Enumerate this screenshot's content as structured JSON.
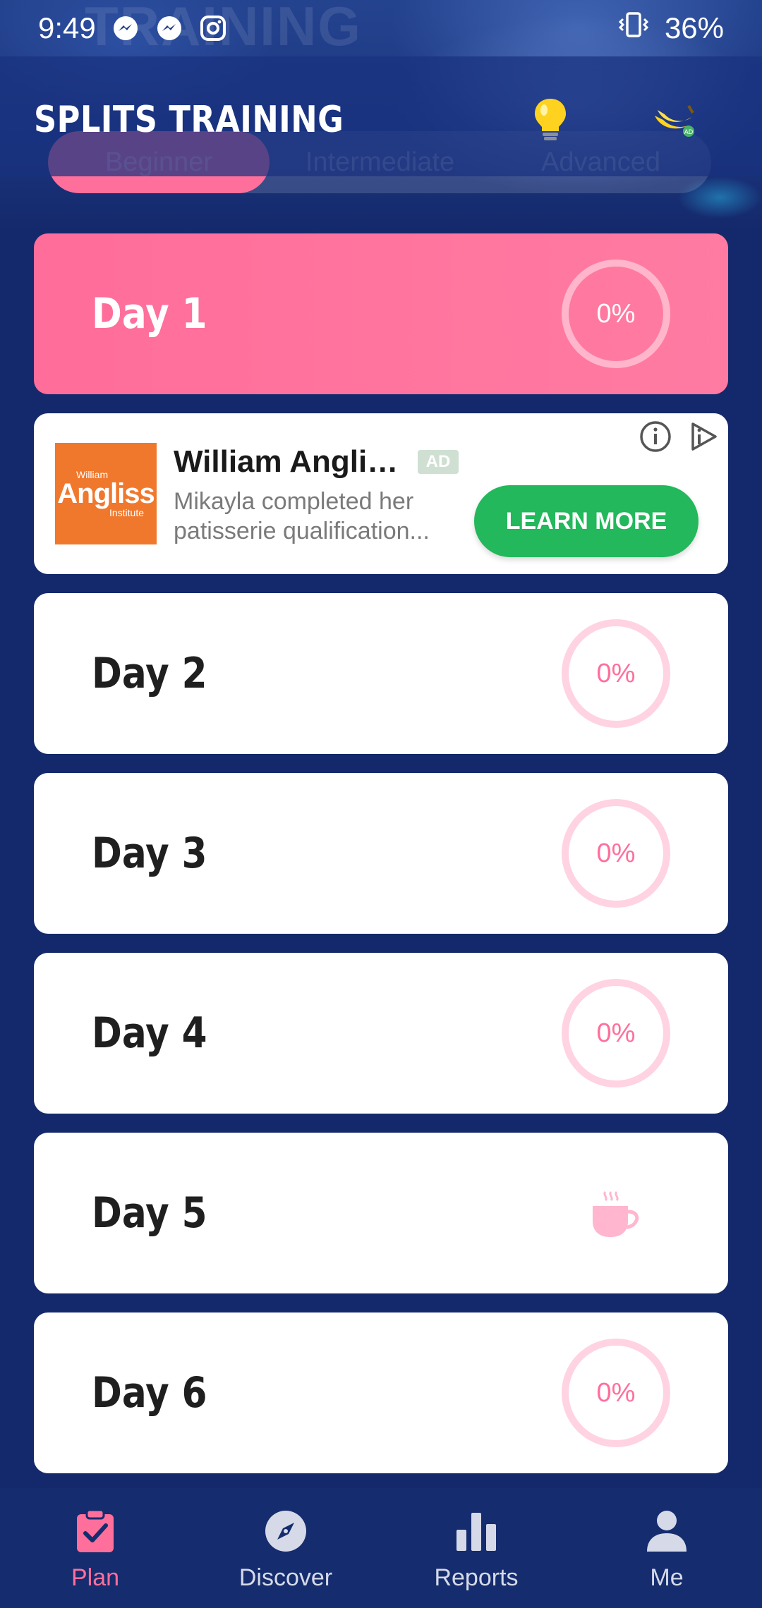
{
  "status_bar": {
    "time": "9:49",
    "app_icons": [
      "messenger-icon",
      "messenger-icon",
      "instagram-icon"
    ],
    "battery": "36%"
  },
  "header": {
    "title": "SPLITS TRAINING",
    "background_text": "TRAINING",
    "level_tabs": [
      {
        "label": "Beginner",
        "active": true
      },
      {
        "label": "Intermediate",
        "active": false
      },
      {
        "label": "Advanced",
        "active": false
      }
    ]
  },
  "days": [
    {
      "label": "Day 1",
      "progress": "0%",
      "active": true
    },
    {
      "label": "Day 2",
      "progress": "0%"
    },
    {
      "label": "Day 3",
      "progress": "0%"
    },
    {
      "label": "Day 4",
      "progress": "0%"
    },
    {
      "label": "Day 5",
      "rest_day": true,
      "icon": "coffee-cup-icon"
    },
    {
      "label": "Day 6",
      "progress": "0%"
    }
  ],
  "ad": {
    "logo_small": "William",
    "logo_main": "Angliss",
    "logo_sub": "Institute",
    "title": "William Anglis...",
    "badge": "AD",
    "body_line1": "Mikayla completed her",
    "body_line2": "patisserie qualification...",
    "cta": "LEARN MORE"
  },
  "bottom_nav": [
    {
      "label": "Plan",
      "icon": "clipboard-check-icon",
      "active": true
    },
    {
      "label": "Discover",
      "icon": "compass-icon"
    },
    {
      "label": "Reports",
      "icon": "bar-chart-icon"
    },
    {
      "label": "Me",
      "icon": "person-icon"
    }
  ],
  "colors": {
    "background": "#14296b",
    "accent_pink": "#ff6f9c",
    "ring_pink": "#ffd3e1",
    "cta_green": "#22b85b"
  }
}
